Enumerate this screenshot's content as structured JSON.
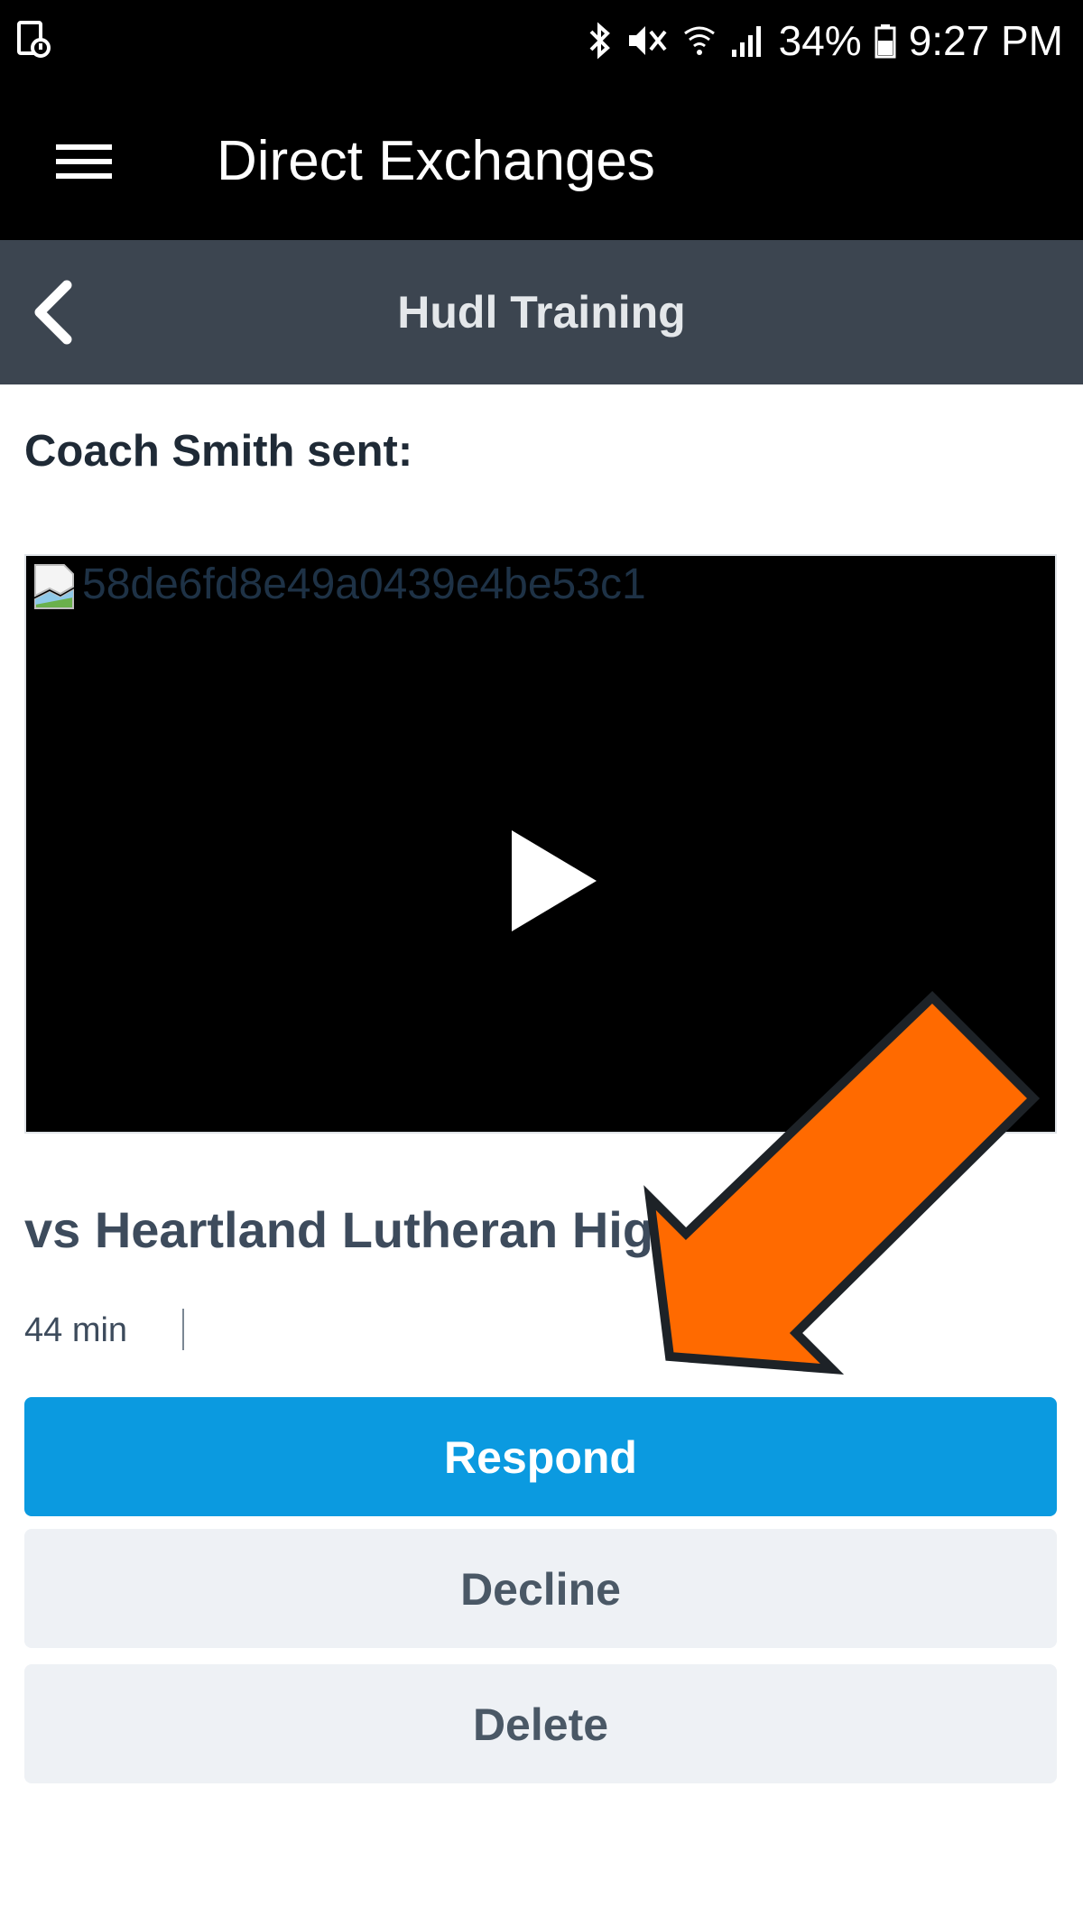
{
  "status_bar": {
    "time": "9:27 PM",
    "battery": "34%",
    "icons": [
      "notification-icon",
      "bluetooth-icon",
      "mute-icon",
      "wifi-icon",
      "signal-icon",
      "battery-icon"
    ]
  },
  "app_bar": {
    "title": "Direct Exchanges",
    "menu_icon": "hamburger-menu-icon"
  },
  "sub_header": {
    "title": "Hudl Training",
    "back_icon": "chevron-left-icon"
  },
  "message": {
    "sender_line": "Coach Smith sent:",
    "image_alt": "58de6fd8e49a0439e4be53c1",
    "video_title": "vs Heartland Lutheran Hig",
    "duration": "44 min"
  },
  "actions": {
    "respond": "Respond",
    "decline": "Decline",
    "delete": "Delete"
  },
  "colors": {
    "primary": "#0b9ae0",
    "header": "#3c4550",
    "annotation_arrow": "#ff6a00"
  }
}
